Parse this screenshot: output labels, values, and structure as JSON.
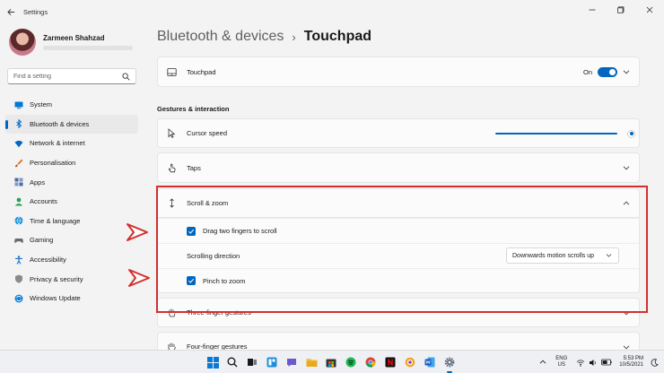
{
  "window": {
    "title": "Settings",
    "back_icon": "back-arrow-icon",
    "minimize_icon": "minimize-icon",
    "maximize_icon": "maximize-icon",
    "close_icon": "close-icon"
  },
  "profile": {
    "name": "Zarmeen Shahzad"
  },
  "search": {
    "placeholder": "Find a setting",
    "icon": "search-icon"
  },
  "sidebar": {
    "items": [
      {
        "label": "System",
        "icon": "system-icon",
        "color": "#0078d4"
      },
      {
        "label": "Bluetooth & devices",
        "icon": "bluetooth-icon",
        "color": "#0067c0",
        "active": true
      },
      {
        "label": "Network & internet",
        "icon": "wifi-icon",
        "color": "#0067c0"
      },
      {
        "label": "Personalisation",
        "icon": "brush-icon",
        "color": "#e0701a"
      },
      {
        "label": "Apps",
        "icon": "apps-icon",
        "color": "#4a6d9c"
      },
      {
        "label": "Accounts",
        "icon": "accounts-icon",
        "color": "#2ba05a"
      },
      {
        "label": "Time & language",
        "icon": "globe-icon",
        "color": "#0c8ed8"
      },
      {
        "label": "Gaming",
        "icon": "gamepad-icon",
        "color": "#6b6b6b"
      },
      {
        "label": "Accessibility",
        "icon": "accessibility-icon",
        "color": "#1a6fc4"
      },
      {
        "label": "Privacy & security",
        "icon": "shield-icon",
        "color": "#6b6b6b"
      },
      {
        "label": "Windows Update",
        "icon": "update-icon",
        "color": "#0a7fd6"
      }
    ]
  },
  "breadcrumb": {
    "parent": "Bluetooth & devices",
    "separator": "›",
    "current": "Touchpad"
  },
  "touchpad_card": {
    "label": "Touchpad",
    "toggle_text": "On",
    "toggle_on": true
  },
  "section_title": "Gestures & interaction",
  "cursor_speed": {
    "label": "Cursor speed",
    "slider_value": 1.0
  },
  "taps": {
    "label": "Taps"
  },
  "scroll_zoom": {
    "label": "Scroll & zoom",
    "drag_two_fingers": {
      "label": "Drag two fingers to scroll",
      "checked": true
    },
    "scrolling_direction": {
      "label": "Scrolling direction",
      "value": "Downwards motion scrolls up"
    },
    "pinch_to_zoom": {
      "label": "Pinch to zoom",
      "checked": true
    }
  },
  "three_finger": {
    "label": "Three-finger gestures"
  },
  "four_finger": {
    "label": "Four-finger gestures"
  },
  "annotation": {
    "highlight_color": "#d32f2f"
  },
  "taskbar": {
    "apps": [
      {
        "icon": "windows-start-icon"
      },
      {
        "icon": "search-icon"
      },
      {
        "icon": "task-view-icon"
      },
      {
        "icon": "widgets-icon"
      },
      {
        "icon": "chat-icon"
      },
      {
        "icon": "file-explorer-icon"
      },
      {
        "icon": "microsoft-store-icon"
      },
      {
        "icon": "spotify-icon"
      },
      {
        "icon": "chrome-icon"
      },
      {
        "icon": "netflix-icon"
      },
      {
        "icon": "photos-icon"
      },
      {
        "icon": "word-icon"
      },
      {
        "icon": "settings-icon",
        "active": true
      }
    ],
    "language_top": "ENG",
    "language_bottom": "US",
    "time": "5:53 PM",
    "date": "10/5/2021"
  },
  "accent_color": "#0067c0"
}
